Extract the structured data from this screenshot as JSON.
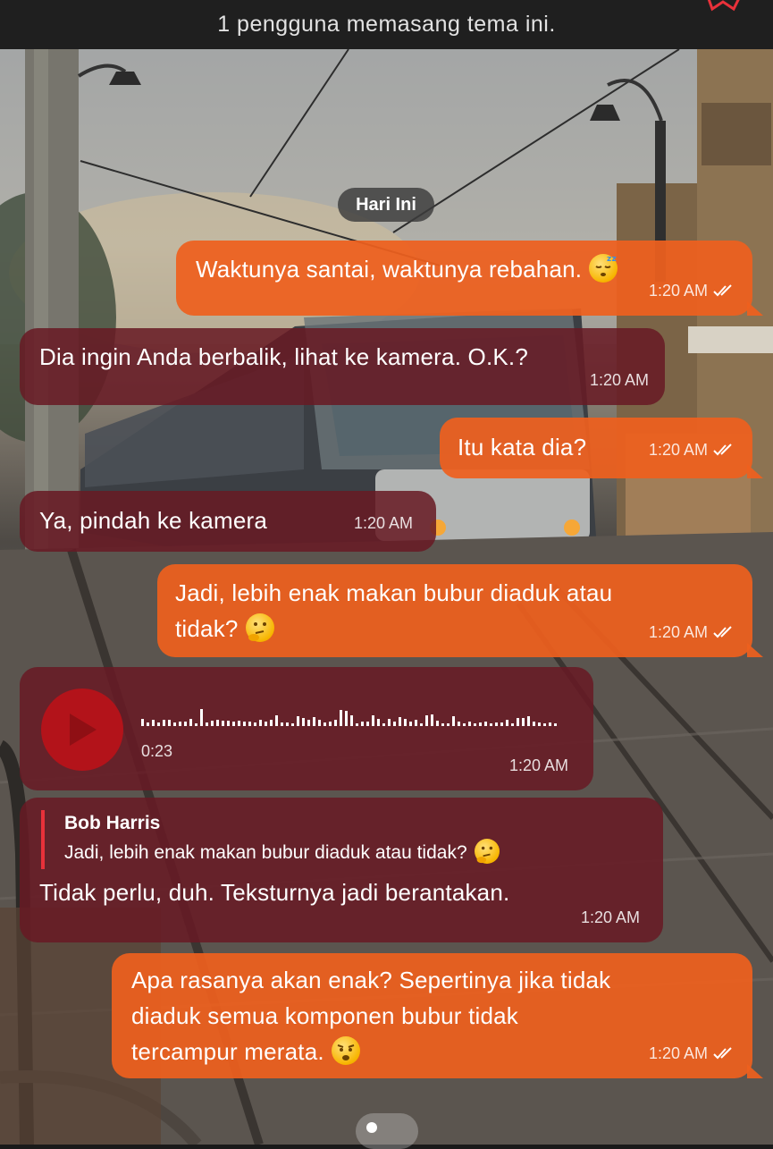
{
  "header": {
    "text": "1 pengguna memasang tema ini.",
    "icon": "heart-outline-icon"
  },
  "date_divider": "Hari Ini",
  "messages": [
    {
      "direction": "out",
      "text": "Waktunya santai, waktunya rebahan.",
      "time": "1:20 AM",
      "emoji": "sleeping-face-emoji"
    },
    {
      "direction": "in",
      "text": "Dia ingin Anda berbalik, lihat ke kamera. O.K.?",
      "time": "1:20 AM"
    },
    {
      "direction": "out",
      "text": "Itu kata dia?",
      "time": "1:20 AM"
    },
    {
      "direction": "in",
      "text": "Ya, pindah ke kamera",
      "time": "1:20 AM"
    },
    {
      "direction": "out",
      "text_line1": "Jadi, lebih enak makan bubur diaduk atau",
      "text_line2": "tidak?",
      "time": "1:20 AM",
      "emoji": "thinking-face-emoji"
    },
    {
      "direction": "in",
      "type": "voice",
      "duration": "0:23",
      "time": "1:20 AM"
    },
    {
      "direction": "in",
      "reply_to": {
        "name": "Bob Harris",
        "text": "Jadi, lebih enak makan bubur diaduk atau tidak?"
      },
      "text": "Tidak perlu, duh. Teksturnya jadi berantakan.",
      "time": "1:20 AM"
    },
    {
      "direction": "out",
      "text_line1": "Apa rasanya akan enak? Sepertinya jika tidak",
      "text_line2": "diaduk semua komponen bubur tidak",
      "text_line3": "tercampur merata.",
      "time": "1:20 AM",
      "emoji": "worried-face-emoji"
    }
  ],
  "colors": {
    "outgoing": "#EE601E",
    "incoming": "#681A24",
    "play": "#B3131A"
  }
}
